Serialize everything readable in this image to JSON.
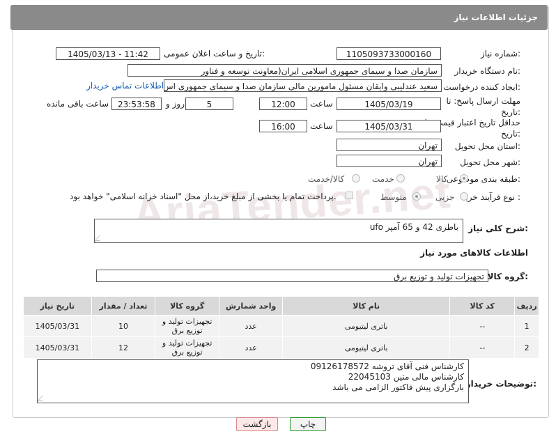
{
  "header": {
    "title": "جزئیات اطلاعات نیاز"
  },
  "watermark": "AriaTender.net",
  "fields": {
    "need_number_label": "شماره نیاز:",
    "need_number": "1105093733000160",
    "announce_label": "تاریخ و ساعت اعلان عمومی:",
    "announce_value": "1405/03/13 - 11:42",
    "buyer_org_label": "نام دستگاه خریدار:",
    "buyer_org": "سازمان صدا و سیمای جمهوری اسلامی ایران(معاونت توسعه و فناور",
    "creator_label": "ایجاد کننده درخواست:",
    "creator": "سعید عندلیبی وایقان مسئول مامورین مالی  سازمان صدا و سیمای جمهوری اس",
    "contact_link": "اطلاعات تماس خریدار",
    "deadline_label": "مهلت ارسال پاسخ: تا تاریخ:",
    "deadline_date": "1405/03/19",
    "time_label": "ساعت",
    "deadline_time": "12:00",
    "days_value": "5",
    "days_label": "روز و",
    "remaining_time": "23:53:58",
    "remaining_label": "ساعت باقی مانده",
    "price_validity_label": "حداقل تاریخ اعتبار قیمت: تا تاریخ:",
    "price_validity_date": "1405/03/31",
    "price_validity_time": "16:00",
    "province_label": "استان محل تحویل:",
    "province": "تهران",
    "city_label": "شهر محل تحویل:",
    "city": "تهران",
    "category_label": "طبقه بندی موضوعی:",
    "category_options": [
      "کالا",
      "خدمت",
      "کالا/خدمت"
    ],
    "process_label": "نوع فرآیند خرید :",
    "process_options": [
      "جزیی",
      "متوسط"
    ],
    "payment_note": "پرداخت تمام یا بخشی از مبلغ خرید،از محل \"اسناد خزانه اسلامی\" خواهد بود."
  },
  "description": {
    "label": "شرح کلی نیاز:",
    "value": "باطری 42 و 65 آمپر ufo"
  },
  "goods_info": {
    "title": "اطلاعات کالاهای مورد نیاز",
    "group_label": "گروه کالا:",
    "group_value": "تجهیزات تولید و توزیع برق"
  },
  "table": {
    "headers": [
      "ردیف",
      "کد کالا",
      "نام کالا",
      "واحد شمارش",
      "گروه کالا",
      "تعداد / مقدار",
      "تاریخ نیاز"
    ],
    "rows": [
      [
        "1",
        "--",
        "باتری لیتیومی",
        "عدد",
        "تجهیزات تولید و توزیع برق",
        "10",
        "1405/03/31"
      ],
      [
        "2",
        "--",
        "باتری لیتیومی",
        "عدد",
        "تجهیزات تولید و توزیع برق",
        "12",
        "1405/03/31"
      ]
    ]
  },
  "buyer_notes": {
    "label": "توضیحات خریدار:",
    "lines": [
      "کارشناس فنی آقای تروشه 09126178572",
      "کارشناس مالی متین 22045103",
      "بارگزاری پیش فاکتور الزامی می باشد"
    ]
  },
  "buttons": {
    "print": "چاپ",
    "back": "بازگشت"
  }
}
